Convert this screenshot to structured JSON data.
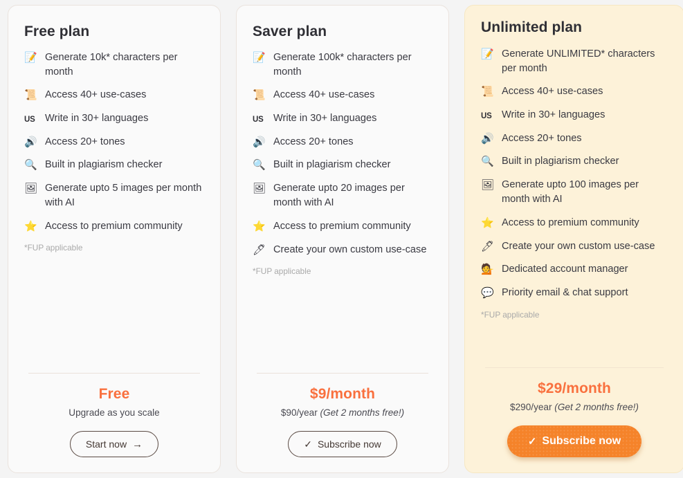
{
  "colors": {
    "page_background": "#f4f4f4",
    "card_background": "#fafafa",
    "highlight_card_background": "#fdf2d9",
    "accent_orange": "#f9703e",
    "button_orange": "#f5832a"
  },
  "plans": [
    {
      "title": "Free plan",
      "highlight": false,
      "features": [
        {
          "icon": "memo-icon",
          "glyph": "📝",
          "text": "Generate 10k* characters per month"
        },
        {
          "icon": "scroll-icon",
          "glyph": "📜",
          "text": "Access 40+ use-cases"
        },
        {
          "icon": "us-flag-icon",
          "glyph": "US",
          "text": "Write in 30+ languages"
        },
        {
          "icon": "speaker-icon",
          "glyph": "🔊",
          "text": "Access 20+ tones"
        },
        {
          "icon": "magnifying-glass-icon",
          "glyph": "🔍",
          "text": "Built in plagiarism checker"
        },
        {
          "icon": "framed-picture-icon",
          "glyph": "🖼",
          "text": "Generate upto 5 images per month with AI"
        },
        {
          "icon": "star-icon",
          "glyph": "⭐",
          "text": "Access to premium community"
        }
      ],
      "fup_note": "*FUP applicable",
      "price_main": "Free",
      "price_sub": "Upgrade as you scale",
      "price_sub_italic": "",
      "cta_label": "Start now",
      "cta_icon": "arrow-right-icon",
      "cta_glyph": "→",
      "cta_style": "outline"
    },
    {
      "title": "Saver plan",
      "highlight": false,
      "features": [
        {
          "icon": "memo-icon",
          "glyph": "📝",
          "text": "Generate 100k* characters per month"
        },
        {
          "icon": "scroll-icon",
          "glyph": "📜",
          "text": "Access 40+ use-cases"
        },
        {
          "icon": "us-flag-icon",
          "glyph": "US",
          "text": "Write in 30+ languages"
        },
        {
          "icon": "speaker-icon",
          "glyph": "🔊",
          "text": "Access 20+ tones"
        },
        {
          "icon": "magnifying-glass-icon",
          "glyph": "🔍",
          "text": "Built in plagiarism checker"
        },
        {
          "icon": "framed-picture-icon",
          "glyph": "🖼",
          "text": "Generate upto 20 images per month with AI"
        },
        {
          "icon": "star-icon",
          "glyph": "⭐",
          "text": "Access to premium community"
        },
        {
          "icon": "pen-icon",
          "glyph": "🖊",
          "text": "Create your own custom use-case"
        }
      ],
      "fup_note": "*FUP applicable",
      "price_main": "$9/month",
      "price_sub": "$90/year ",
      "price_sub_italic": "(Get 2 months free!)",
      "cta_label": "Subscribe now",
      "cta_icon": "check-icon",
      "cta_glyph": "✓",
      "cta_style": "outline"
    },
    {
      "title": "Unlimited plan",
      "highlight": true,
      "features": [
        {
          "icon": "memo-icon",
          "glyph": "📝",
          "text": "Generate UNLIMITED* characters per month"
        },
        {
          "icon": "scroll-icon",
          "glyph": "📜",
          "text": "Access 40+ use-cases"
        },
        {
          "icon": "us-flag-icon",
          "glyph": "US",
          "text": "Write in 30+ languages"
        },
        {
          "icon": "speaker-icon",
          "glyph": "🔊",
          "text": "Access 20+ tones"
        },
        {
          "icon": "magnifying-glass-icon",
          "glyph": "🔍",
          "text": "Built in plagiarism checker"
        },
        {
          "icon": "framed-picture-icon",
          "glyph": "🖼",
          "text": "Generate upto 100 images per month with AI"
        },
        {
          "icon": "star-icon",
          "glyph": "⭐",
          "text": "Access to premium community"
        },
        {
          "icon": "pen-icon",
          "glyph": "🖊",
          "text": "Create your own custom use-case"
        },
        {
          "icon": "account-manager-icon",
          "glyph": "💁",
          "text": "Dedicated account manager"
        },
        {
          "icon": "speech-balloon-icon",
          "glyph": "💬",
          "text": "Priority email & chat support"
        }
      ],
      "fup_note": "*FUP applicable",
      "price_main": "$29/month",
      "price_sub": "$290/year ",
      "price_sub_italic": "(Get 2 months free!)",
      "cta_label": "Subscribe now",
      "cta_icon": "check-icon",
      "cta_glyph": "✓",
      "cta_style": "solid"
    }
  ]
}
